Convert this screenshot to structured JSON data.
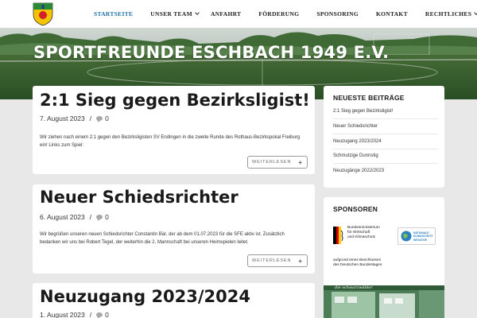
{
  "nav": {
    "items": [
      {
        "label": "STARTSEITE",
        "active": true,
        "has_dropdown": false
      },
      {
        "label": "UNSER TEAM",
        "active": false,
        "has_dropdown": true
      },
      {
        "label": "ANFAHRT",
        "active": false,
        "has_dropdown": false
      },
      {
        "label": "FÖRDERUNG",
        "active": false,
        "has_dropdown": false
      },
      {
        "label": "SPONSORING",
        "active": false,
        "has_dropdown": false
      },
      {
        "label": "KONTAKT",
        "active": false,
        "has_dropdown": false
      },
      {
        "label": "RECHTLICHES",
        "active": false,
        "has_dropdown": true
      }
    ]
  },
  "hero": {
    "title": "SPORTFREUNDE ESCHBACH 1949 E.V."
  },
  "posts": [
    {
      "title": "2:1 Sieg gegen Bezirksligist!",
      "date": "7. August 2023",
      "comments": "0",
      "excerpt": "Wir ziehen nach einem 2:1 gegen den Bezirksligisten SV Endingen in die zweite Runde des Rothaus-Bezirkspokal Freiburg ein! Links zum Spiel:",
      "read_more": "WEITERLESEN"
    },
    {
      "title": "Neuer Schiedsrichter",
      "date": "6. August 2023",
      "comments": "0",
      "excerpt": "Wir begrüßen unseren neuen Schiedsrichter Constantin Bär, der ab dem 01.07.2023 für die SFE aktiv ist. Zusätzlich bedanken wir uns bei Robert Tegel, der weiterhin die 2. Mannschaft bei unseren Heimspielen leitet.",
      "read_more": "WEITERLESEN"
    },
    {
      "title": "Neuzugang 2023/2024",
      "date": "1. August 2023",
      "comments": "0"
    }
  ],
  "sidebar": {
    "recent": {
      "title": "NEUESTE BEITRÄGE",
      "links": [
        "2:1 Sieg gegen Bezirksligist!",
        "Neuer Schiedsrichter",
        "Neuzugang 2023/2024",
        "Schmutzige Dunnstig",
        "Neuzugänge 2022/2023"
      ]
    },
    "sponsors": {
      "title": "SPONSOREN",
      "bmwk_line1": "Bundesministerium",
      "bmwk_line2": "für Wirtschaft",
      "bmwk_line3": "und Klimaschutz",
      "nki_line1": "NATIONALE",
      "nki_line2": "KLIMASCHUTZ",
      "nki_line3": "INITIATIVE",
      "resolution_line1": "aufgrund eines Beschlusses",
      "resolution_line2": "des Deutschen Bundestages",
      "banner_text": "die schwarzwälder"
    }
  },
  "colors": {
    "accent": "#1d6fa5",
    "post_bg": "#ffffff",
    "page_bg": "#e8e8e8",
    "crest_yellow": "#f2c500",
    "crest_green": "#2a8a3a",
    "crest_red": "#d3202b"
  }
}
